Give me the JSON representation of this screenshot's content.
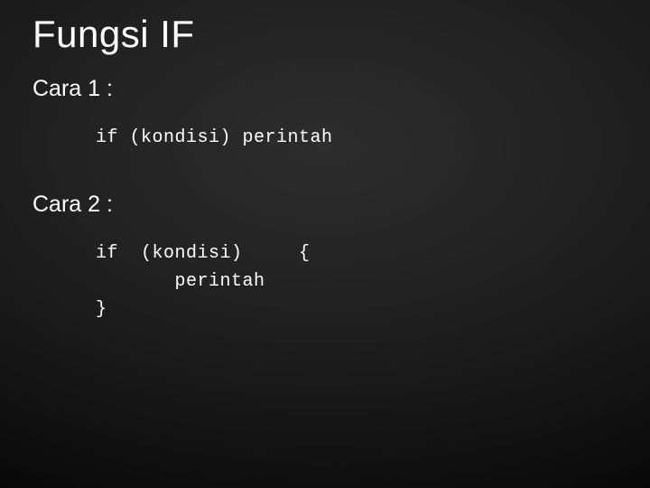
{
  "slide": {
    "title": "Fungsi IF",
    "section1": {
      "heading": "Cara 1 :",
      "code": "if (kondisi) perintah"
    },
    "section2": {
      "heading": "Cara 2 :",
      "code": "if  (kondisi)     {\n       perintah\n}"
    }
  }
}
